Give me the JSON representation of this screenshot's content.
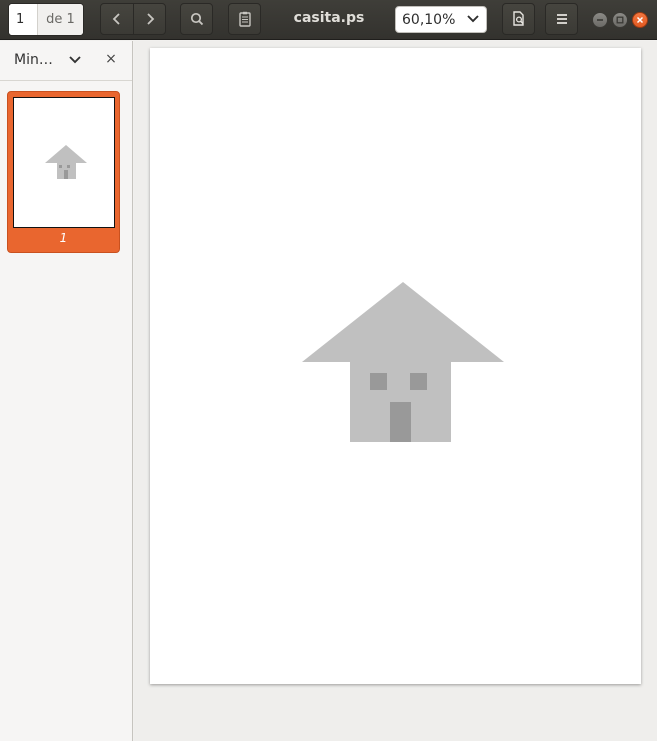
{
  "toolbar": {
    "page_current": "1",
    "page_of": "de 1",
    "title": "casita.ps",
    "zoom": "60,10%",
    "buttons": {
      "prev": "chevron-left-icon",
      "next": "chevron-right-icon",
      "search": "search-icon",
      "annotations": "clipboard-icon",
      "doc_properties": "document-search-icon",
      "menu": "hamburger-menu-icon"
    }
  },
  "sidebar": {
    "title": "Min…",
    "close": "×",
    "thumbnails": [
      {
        "label": "1"
      }
    ]
  },
  "colors": {
    "accent": "#e9662f",
    "house": "#c0c0c0",
    "house_detail": "#999999"
  }
}
